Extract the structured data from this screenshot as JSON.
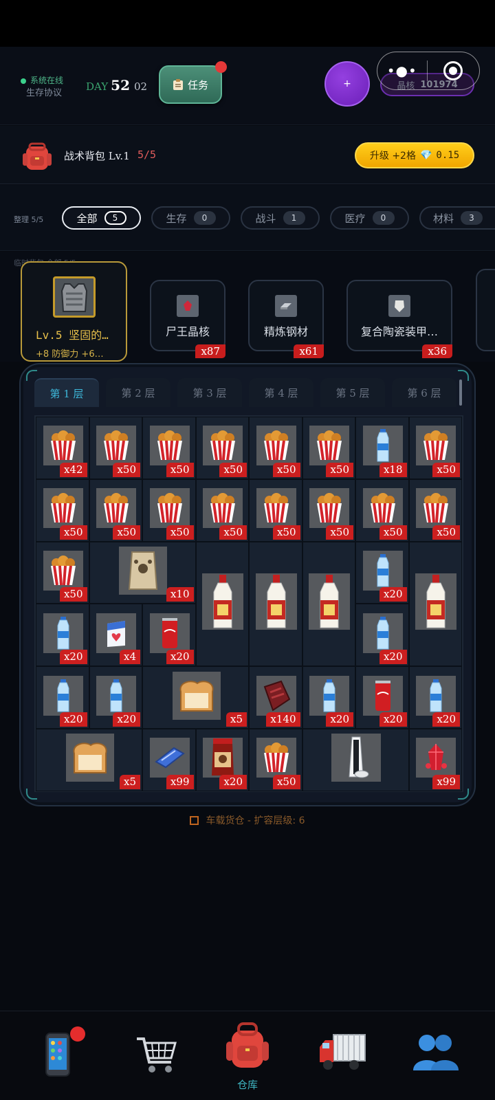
{
  "header": {
    "online_text": "系统在线",
    "protocol_text": "生存协议",
    "day_prefix": "DAY",
    "day_number": "52",
    "day_sub": "02",
    "task_label": "任务",
    "crystal_label": "晶核",
    "crystal_value": "101974",
    "plus_symbol": "+"
  },
  "backpack": {
    "title": "战术背包 Lv.1",
    "count": "5/5",
    "upgrade_label": "升级 +2格",
    "upgrade_cost": "0.15"
  },
  "categories": {
    "sort_label": "整理 5/5",
    "tabs": [
      {
        "label": "全部",
        "count": "5"
      },
      {
        "label": "生存",
        "count": "0"
      },
      {
        "label": "战斗",
        "count": "1"
      },
      {
        "label": "医疗",
        "count": "0"
      },
      {
        "label": "材料",
        "count": "3"
      }
    ]
  },
  "temp_bag": {
    "label": "临时背包   全部   5/5",
    "armor": {
      "level_name": "Lv.5 坚固的…",
      "stats": "+8 防御力 +6…"
    },
    "items": [
      {
        "name": "尸王晶核",
        "qty": "x87"
      },
      {
        "name": "精炼钢材",
        "qty": "x61"
      },
      {
        "name": "复合陶瓷装甲…",
        "qty": "x36"
      }
    ]
  },
  "warehouse": {
    "layers": [
      "第 1 层",
      "第 2 层",
      "第 3 层",
      "第 4 层",
      "第 5 层",
      "第 6 层"
    ],
    "active_layer": 0,
    "footnote": "车载货仓  -  扩容层级: 6"
  },
  "grid_items": [
    {
      "kind": "chicken",
      "qty": "x42"
    },
    {
      "kind": "chicken",
      "qty": "x50"
    },
    {
      "kind": "chicken",
      "qty": "x50"
    },
    {
      "kind": "chicken",
      "qty": "x50"
    },
    {
      "kind": "chicken",
      "qty": "x50"
    },
    {
      "kind": "chicken",
      "qty": "x50"
    },
    {
      "kind": "water",
      "qty": "x18"
    },
    {
      "kind": "chicken",
      "qty": "x50"
    },
    {
      "kind": "chicken",
      "qty": "x50"
    },
    {
      "kind": "chicken",
      "qty": "x50"
    },
    {
      "kind": "chicken",
      "qty": "x50"
    },
    {
      "kind": "chicken",
      "qty": "x50"
    },
    {
      "kind": "chicken",
      "qty": "x50"
    },
    {
      "kind": "chicken",
      "qty": "x50"
    },
    {
      "kind": "chicken",
      "qty": "x50"
    },
    {
      "kind": "chicken",
      "qty": "x50"
    },
    {
      "kind": "chicken",
      "qty": "x50"
    },
    {
      "kind": "dogfood",
      "qty": "x10"
    },
    {
      "kind": "maotai",
      "qty": ""
    },
    {
      "kind": "maotai",
      "qty": ""
    },
    {
      "kind": "maotai",
      "qty": ""
    },
    {
      "kind": "water",
      "qty": "x20"
    },
    {
      "kind": "maotai",
      "qty": ""
    },
    {
      "kind": "water",
      "qty": "x20"
    },
    {
      "kind": "milk",
      "qty": "x4"
    },
    {
      "kind": "cola",
      "qty": "x20"
    },
    {
      "kind": "water",
      "qty": "x20"
    },
    {
      "kind": "water",
      "qty": "x20"
    },
    {
      "kind": "water",
      "qty": "x20"
    },
    {
      "kind": "bread",
      "qty": "x5"
    },
    {
      "kind": "jerky",
      "qty": "x140"
    },
    {
      "kind": "water",
      "qty": "x20"
    },
    {
      "kind": "cola",
      "qty": "x20"
    },
    {
      "kind": "water",
      "qty": "x20"
    },
    {
      "kind": "bread",
      "qty": "x5"
    },
    {
      "kind": "candy",
      "qty": "x99"
    },
    {
      "kind": "chili",
      "qty": "x20"
    },
    {
      "kind": "chicken",
      "qty": "x50"
    },
    {
      "kind": "console",
      "qty": ""
    },
    {
      "kind": "crystal",
      "qty": "x99"
    }
  ],
  "nav": {
    "items": [
      "phone-icon",
      "shopping-cart-icon",
      "backpack-icon",
      "truck-icon",
      "team-icon"
    ],
    "active_label": "仓库"
  }
}
